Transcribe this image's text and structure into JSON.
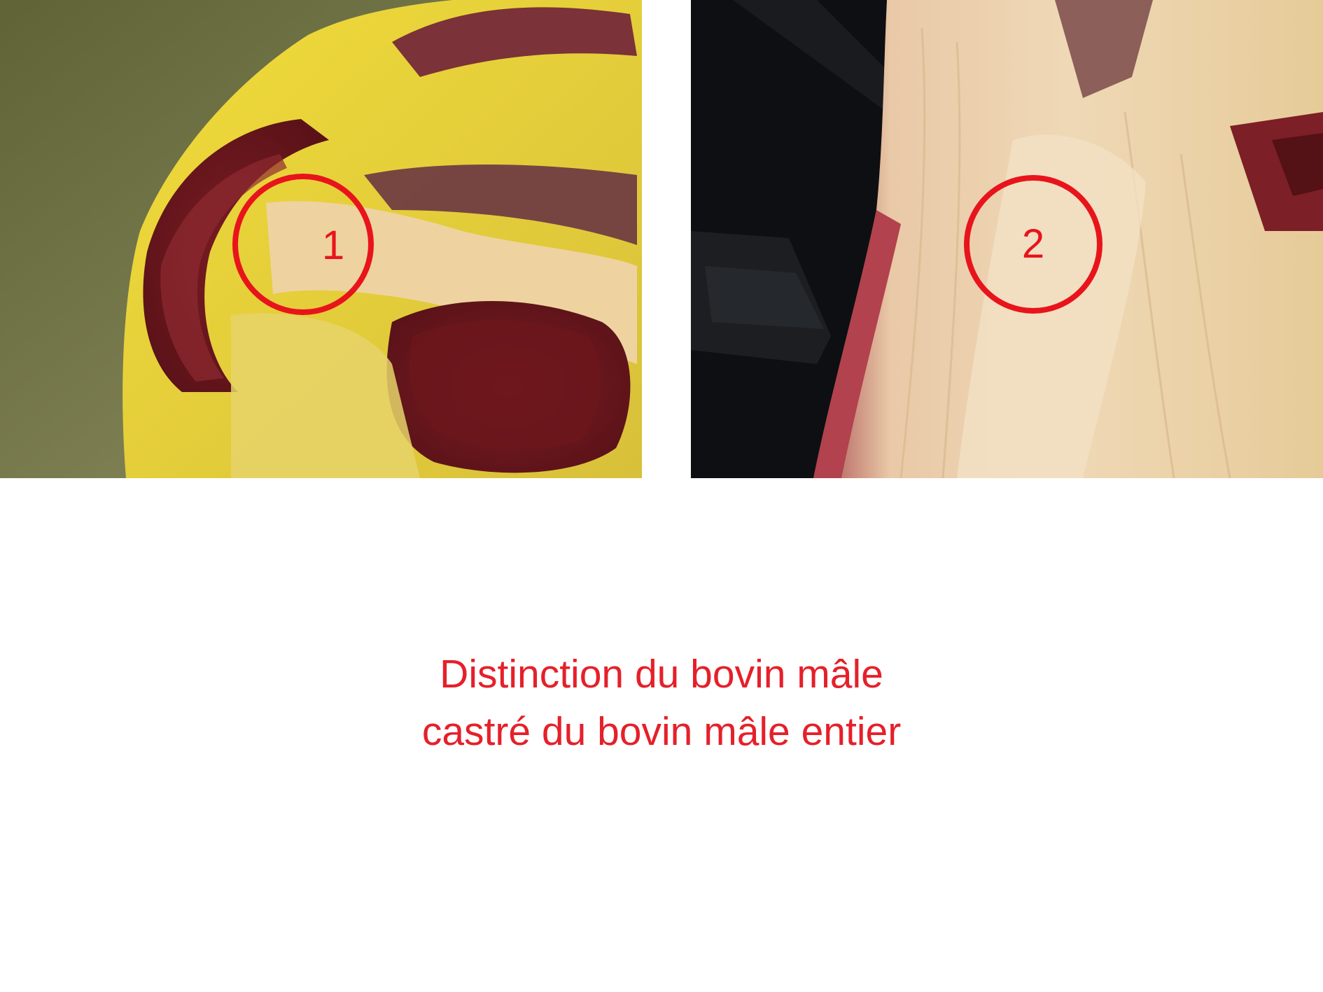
{
  "markers": {
    "left_number": "1",
    "right_number": "2",
    "color": "#e8141c"
  },
  "caption": {
    "line1": "Distinction du bovin mâle",
    "line2": "castré du bovin mâle entier",
    "color": "#e5202a"
  }
}
